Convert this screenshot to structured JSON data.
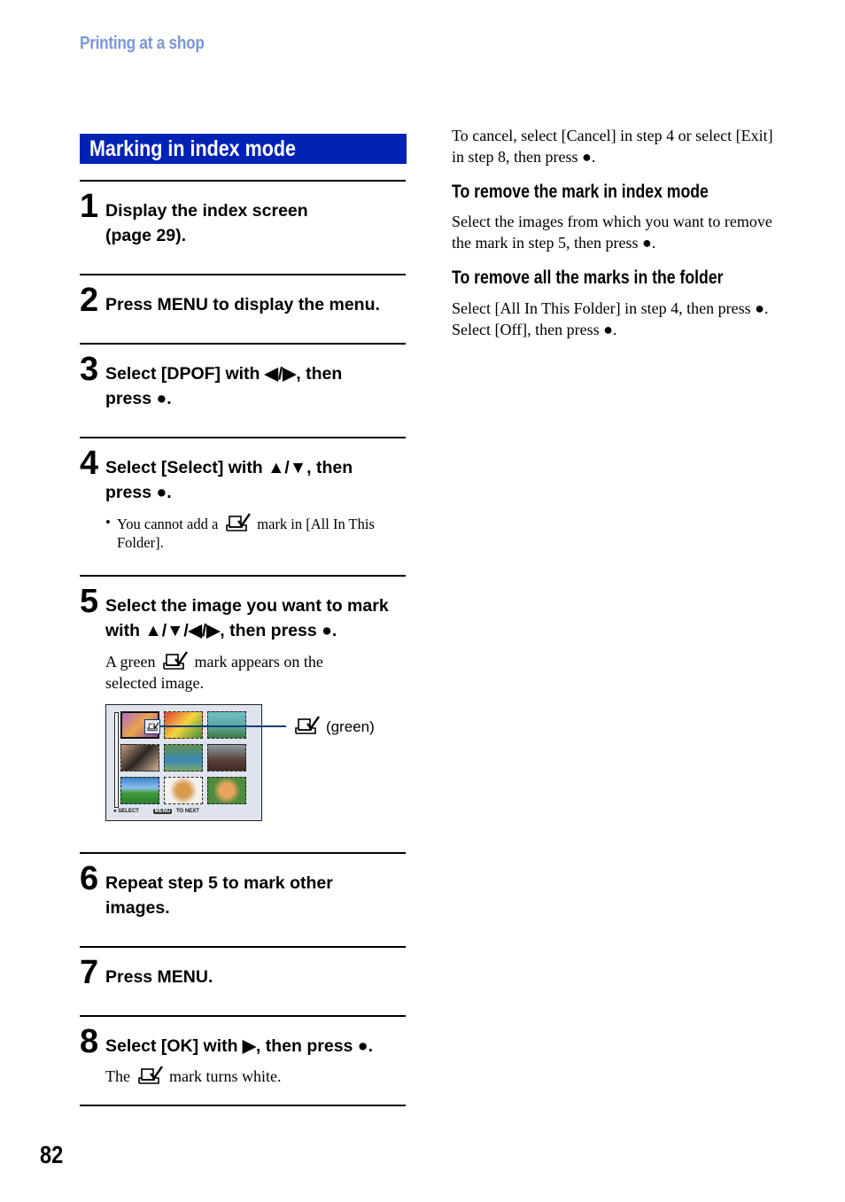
{
  "header": {
    "section_title": "Printing at a shop"
  },
  "section": {
    "title": "Marking in index mode"
  },
  "steps": [
    {
      "number": "1",
      "title": "Display the index screen (page 29)."
    },
    {
      "number": "2",
      "title": "Press MENU to display the menu."
    },
    {
      "number": "3",
      "title": "Select [DPOF] with ◀/▶, then press ●."
    },
    {
      "number": "4",
      "title": "Select [Select] with ▲/▼, then press ●.",
      "note_before_icon": "You cannot add a",
      "note_after_icon": "mark in [All In This Folder]."
    },
    {
      "number": "5",
      "title": "Select the image you want to mark with ▲/▼/◀/▶, then press ●.",
      "desc_before_icon": "A green",
      "desc_after_icon": "mark appears on the selected image."
    },
    {
      "number": "6",
      "title": "Repeat step 5 to mark other images."
    },
    {
      "number": "7",
      "title": "Press MENU."
    },
    {
      "number": "8",
      "title": "Select [OK] with ▶, then press ●.",
      "desc_before_icon": "The",
      "desc_after_icon": "mark turns white."
    }
  ],
  "bullet": "•",
  "screen": {
    "footer_select": "● SELECT",
    "footer_menu": "MENU",
    "footer_next": "TO NEXT",
    "callout_label": "(green)",
    "icon": "dpof-print-mark-icon",
    "thumbnails": [
      {
        "subject": "purple flower",
        "selected": true,
        "marked": true
      },
      {
        "subject": "red flower",
        "selected": false,
        "marked": false
      },
      {
        "subject": "tree landscape",
        "selected": false,
        "marked": false
      },
      {
        "subject": "cat",
        "selected": false,
        "marked": false
      },
      {
        "subject": "child",
        "selected": false,
        "marked": false
      },
      {
        "subject": "tree",
        "selected": false,
        "marked": false
      },
      {
        "subject": "field",
        "selected": false,
        "marked": false
      },
      {
        "subject": "dog",
        "selected": false,
        "marked": false
      },
      {
        "subject": "shiba dog",
        "selected": false,
        "marked": false
      }
    ]
  },
  "right_column": {
    "cancel_text": "To cancel, select [Cancel] in step 4 or select [Exit] in step 8, then press ●.",
    "sections": [
      {
        "heading": "To remove the mark in index mode",
        "body": "Select the images from which you want to remove the mark in step 5, then press ●."
      },
      {
        "heading": "To remove all the marks in the folder",
        "body": "Select [All In This Folder] in step 4, then press ●. Select [Off], then press ●."
      }
    ]
  },
  "colors": {
    "section_bar": "#0022b4",
    "header_text": "#7b96d6"
  },
  "page_number": "82"
}
